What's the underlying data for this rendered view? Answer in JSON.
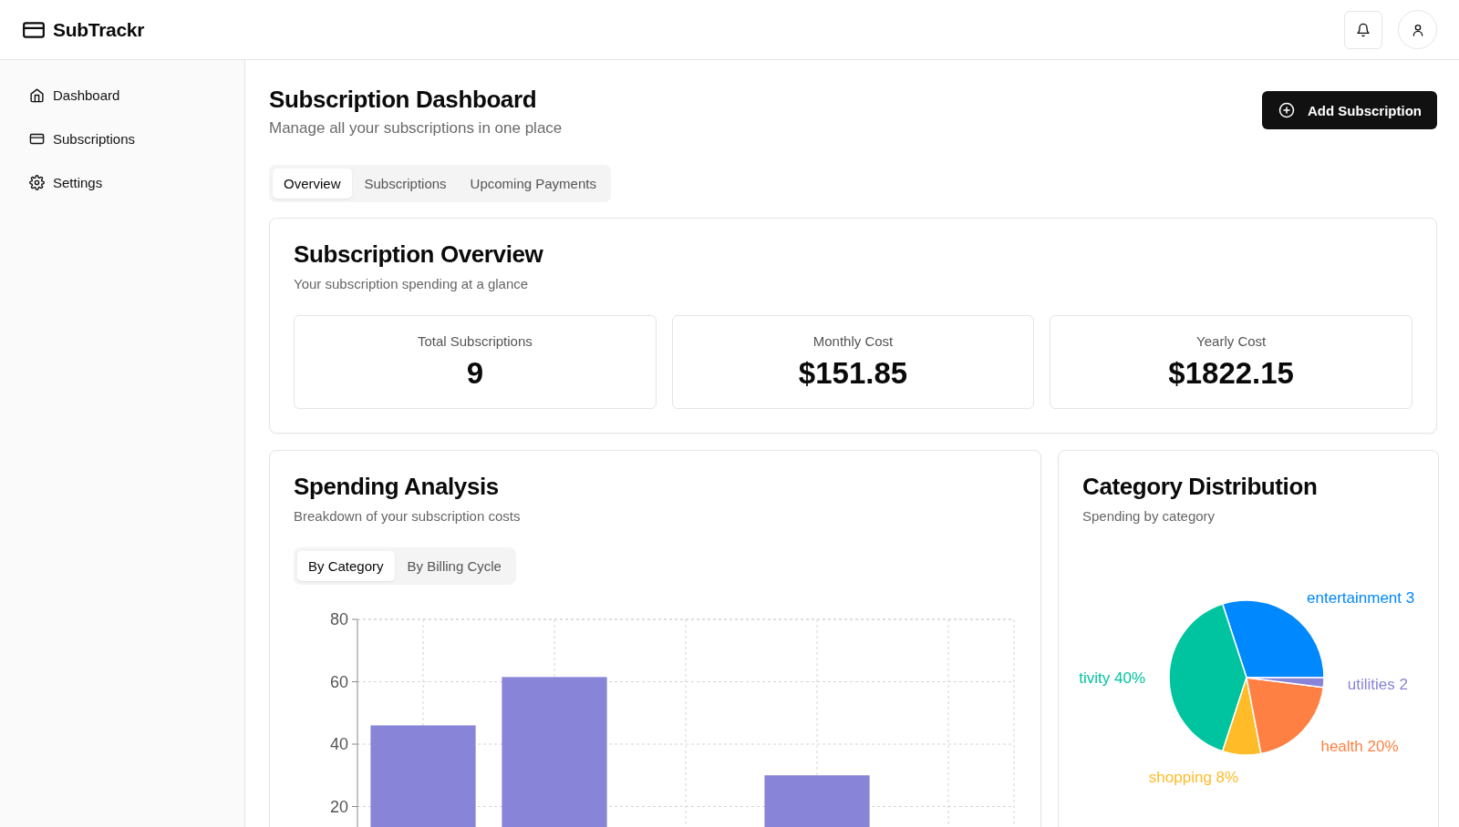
{
  "header": {
    "app_name": "SubTrackr"
  },
  "sidebar": {
    "items": [
      {
        "kind": "home",
        "label": "Dashboard"
      },
      {
        "kind": "card",
        "label": "Subscriptions"
      },
      {
        "kind": "gear",
        "label": "Settings"
      }
    ]
  },
  "page": {
    "title": "Subscription Dashboard",
    "subtitle": "Manage all your subscriptions in one place",
    "add_button": "Add Subscription"
  },
  "tabs": [
    {
      "label": "Overview",
      "selected": true
    },
    {
      "label": "Subscriptions",
      "selected": false
    },
    {
      "label": "Upcoming Payments",
      "selected": false
    }
  ],
  "overview": {
    "title": "Subscription Overview",
    "subtitle": "Your subscription spending at a glance",
    "stats": [
      {
        "label": "Total Subscriptions",
        "value": "9"
      },
      {
        "label": "Monthly Cost",
        "value": "$151.85"
      },
      {
        "label": "Yearly Cost",
        "value": "$1822.15"
      }
    ]
  },
  "spending": {
    "title": "Spending Analysis",
    "subtitle": "Breakdown of your subscription costs",
    "tabs": [
      {
        "label": "By Category",
        "selected": true
      },
      {
        "label": "By Billing Cycle",
        "selected": false
      }
    ],
    "chart_data": {
      "type": "bar",
      "ylim": [
        0,
        80
      ],
      "yticks": [
        20,
        40,
        60,
        80
      ],
      "grid": true,
      "color": "#8884d8",
      "values": [
        46,
        61.5,
        null,
        30,
        null
      ]
    }
  },
  "category": {
    "title": "Category Distribution",
    "subtitle": "Spending by category",
    "chart_data": {
      "type": "pie",
      "categories": [
        "entertainment 3",
        "tivity 40%",
        "shopping 8%",
        "health 20%",
        "utilities 2"
      ],
      "values": [
        30,
        40,
        8,
        20,
        2
      ],
      "colors": [
        "#0088fe",
        "#00c49f",
        "#ffbb28",
        "#ff8042",
        "#8884d8"
      ]
    }
  }
}
